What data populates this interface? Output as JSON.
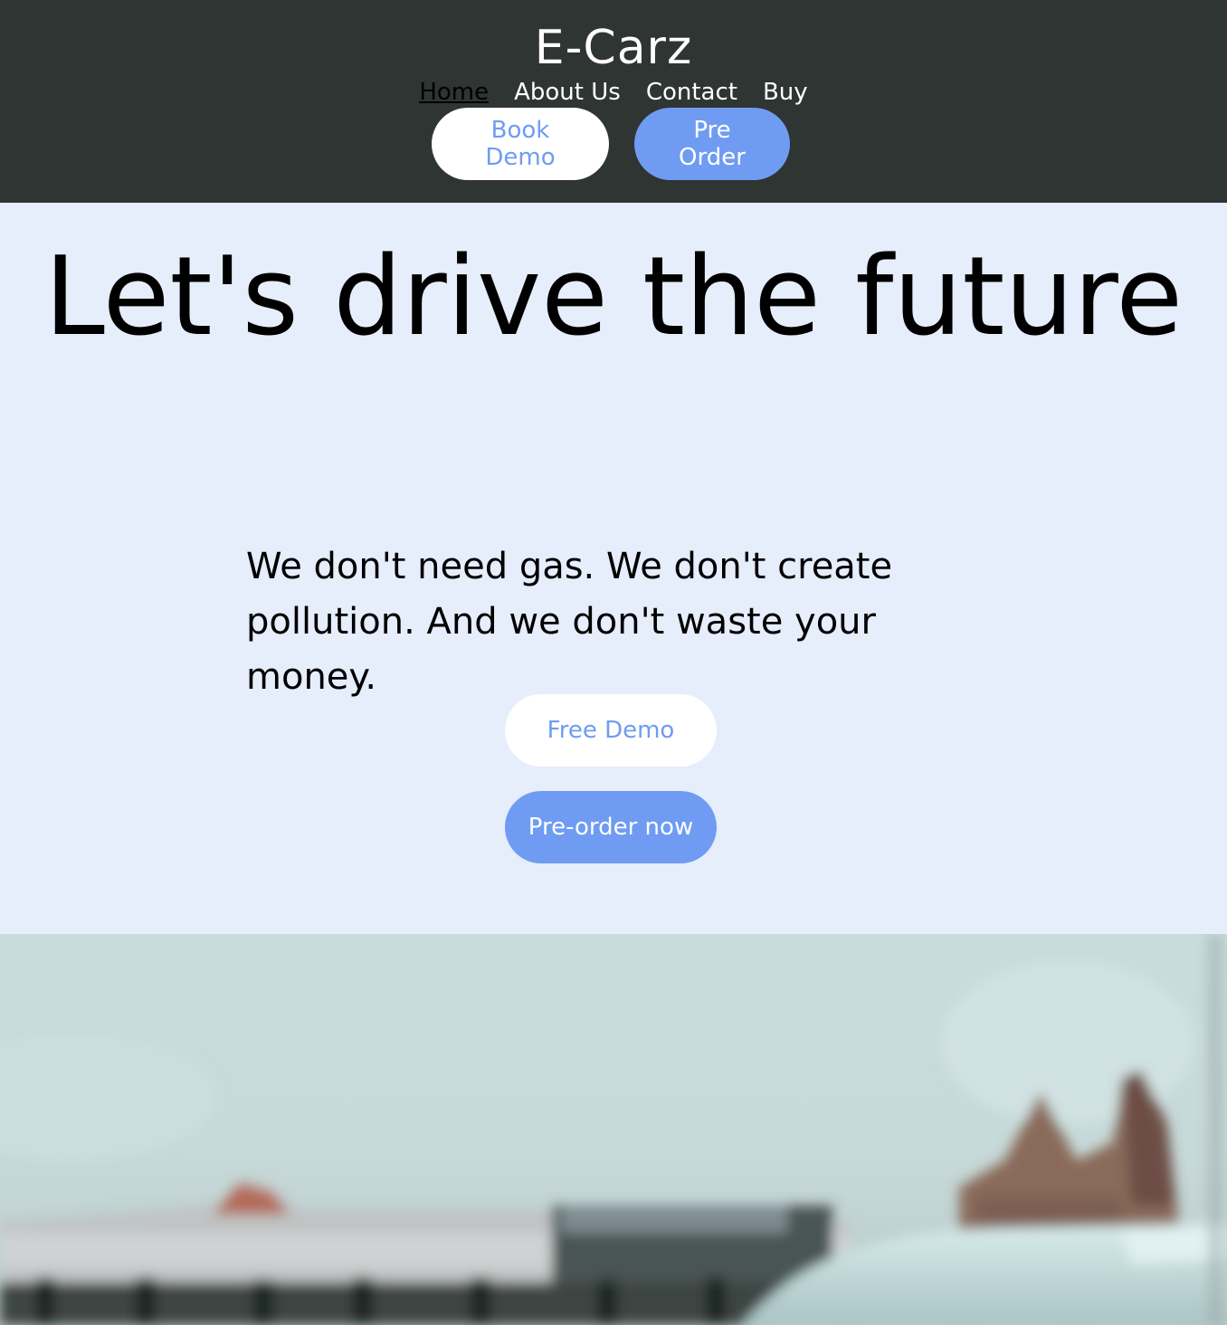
{
  "brand": "E-Carz",
  "nav": {
    "items": [
      {
        "label": "Home",
        "active": true
      },
      {
        "label": "About Us",
        "active": false
      },
      {
        "label": "Contact",
        "active": false
      },
      {
        "label": "Buy",
        "active": false
      }
    ]
  },
  "header_buttons": {
    "book_demo": "Book Demo",
    "pre_order": "Pre Order"
  },
  "hero": {
    "title": "Let's drive the future",
    "text": "We don't need gas. We don't create pollution. And we don't waste your money.",
    "free_demo": "Free Demo",
    "pre_order_now": "Pre-order now"
  },
  "colors": {
    "header_bg": "#2f3532",
    "hero_bg": "#e6edfb",
    "accent": "#6f9cf2"
  }
}
